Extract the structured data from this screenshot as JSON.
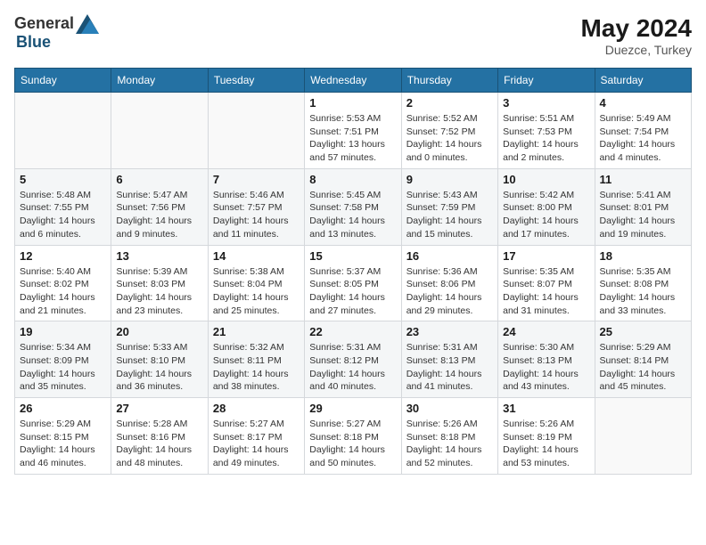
{
  "header": {
    "logo_general": "General",
    "logo_blue": "Blue",
    "month_year": "May 2024",
    "location": "Duezce, Turkey"
  },
  "weekdays": [
    "Sunday",
    "Monday",
    "Tuesday",
    "Wednesday",
    "Thursday",
    "Friday",
    "Saturday"
  ],
  "weeks": [
    [
      {
        "day": "",
        "info": ""
      },
      {
        "day": "",
        "info": ""
      },
      {
        "day": "",
        "info": ""
      },
      {
        "day": "1",
        "info": "Sunrise: 5:53 AM\nSunset: 7:51 PM\nDaylight: 13 hours\nand 57 minutes."
      },
      {
        "day": "2",
        "info": "Sunrise: 5:52 AM\nSunset: 7:52 PM\nDaylight: 14 hours\nand 0 minutes."
      },
      {
        "day": "3",
        "info": "Sunrise: 5:51 AM\nSunset: 7:53 PM\nDaylight: 14 hours\nand 2 minutes."
      },
      {
        "day": "4",
        "info": "Sunrise: 5:49 AM\nSunset: 7:54 PM\nDaylight: 14 hours\nand 4 minutes."
      }
    ],
    [
      {
        "day": "5",
        "info": "Sunrise: 5:48 AM\nSunset: 7:55 PM\nDaylight: 14 hours\nand 6 minutes."
      },
      {
        "day": "6",
        "info": "Sunrise: 5:47 AM\nSunset: 7:56 PM\nDaylight: 14 hours\nand 9 minutes."
      },
      {
        "day": "7",
        "info": "Sunrise: 5:46 AM\nSunset: 7:57 PM\nDaylight: 14 hours\nand 11 minutes."
      },
      {
        "day": "8",
        "info": "Sunrise: 5:45 AM\nSunset: 7:58 PM\nDaylight: 14 hours\nand 13 minutes."
      },
      {
        "day": "9",
        "info": "Sunrise: 5:43 AM\nSunset: 7:59 PM\nDaylight: 14 hours\nand 15 minutes."
      },
      {
        "day": "10",
        "info": "Sunrise: 5:42 AM\nSunset: 8:00 PM\nDaylight: 14 hours\nand 17 minutes."
      },
      {
        "day": "11",
        "info": "Sunrise: 5:41 AM\nSunset: 8:01 PM\nDaylight: 14 hours\nand 19 minutes."
      }
    ],
    [
      {
        "day": "12",
        "info": "Sunrise: 5:40 AM\nSunset: 8:02 PM\nDaylight: 14 hours\nand 21 minutes."
      },
      {
        "day": "13",
        "info": "Sunrise: 5:39 AM\nSunset: 8:03 PM\nDaylight: 14 hours\nand 23 minutes."
      },
      {
        "day": "14",
        "info": "Sunrise: 5:38 AM\nSunset: 8:04 PM\nDaylight: 14 hours\nand 25 minutes."
      },
      {
        "day": "15",
        "info": "Sunrise: 5:37 AM\nSunset: 8:05 PM\nDaylight: 14 hours\nand 27 minutes."
      },
      {
        "day": "16",
        "info": "Sunrise: 5:36 AM\nSunset: 8:06 PM\nDaylight: 14 hours\nand 29 minutes."
      },
      {
        "day": "17",
        "info": "Sunrise: 5:35 AM\nSunset: 8:07 PM\nDaylight: 14 hours\nand 31 minutes."
      },
      {
        "day": "18",
        "info": "Sunrise: 5:35 AM\nSunset: 8:08 PM\nDaylight: 14 hours\nand 33 minutes."
      }
    ],
    [
      {
        "day": "19",
        "info": "Sunrise: 5:34 AM\nSunset: 8:09 PM\nDaylight: 14 hours\nand 35 minutes."
      },
      {
        "day": "20",
        "info": "Sunrise: 5:33 AM\nSunset: 8:10 PM\nDaylight: 14 hours\nand 36 minutes."
      },
      {
        "day": "21",
        "info": "Sunrise: 5:32 AM\nSunset: 8:11 PM\nDaylight: 14 hours\nand 38 minutes."
      },
      {
        "day": "22",
        "info": "Sunrise: 5:31 AM\nSunset: 8:12 PM\nDaylight: 14 hours\nand 40 minutes."
      },
      {
        "day": "23",
        "info": "Sunrise: 5:31 AM\nSunset: 8:13 PM\nDaylight: 14 hours\nand 41 minutes."
      },
      {
        "day": "24",
        "info": "Sunrise: 5:30 AM\nSunset: 8:13 PM\nDaylight: 14 hours\nand 43 minutes."
      },
      {
        "day": "25",
        "info": "Sunrise: 5:29 AM\nSunset: 8:14 PM\nDaylight: 14 hours\nand 45 minutes."
      }
    ],
    [
      {
        "day": "26",
        "info": "Sunrise: 5:29 AM\nSunset: 8:15 PM\nDaylight: 14 hours\nand 46 minutes."
      },
      {
        "day": "27",
        "info": "Sunrise: 5:28 AM\nSunset: 8:16 PM\nDaylight: 14 hours\nand 48 minutes."
      },
      {
        "day": "28",
        "info": "Sunrise: 5:27 AM\nSunset: 8:17 PM\nDaylight: 14 hours\nand 49 minutes."
      },
      {
        "day": "29",
        "info": "Sunrise: 5:27 AM\nSunset: 8:18 PM\nDaylight: 14 hours\nand 50 minutes."
      },
      {
        "day": "30",
        "info": "Sunrise: 5:26 AM\nSunset: 8:18 PM\nDaylight: 14 hours\nand 52 minutes."
      },
      {
        "day": "31",
        "info": "Sunrise: 5:26 AM\nSunset: 8:19 PM\nDaylight: 14 hours\nand 53 minutes."
      },
      {
        "day": "",
        "info": ""
      }
    ]
  ]
}
